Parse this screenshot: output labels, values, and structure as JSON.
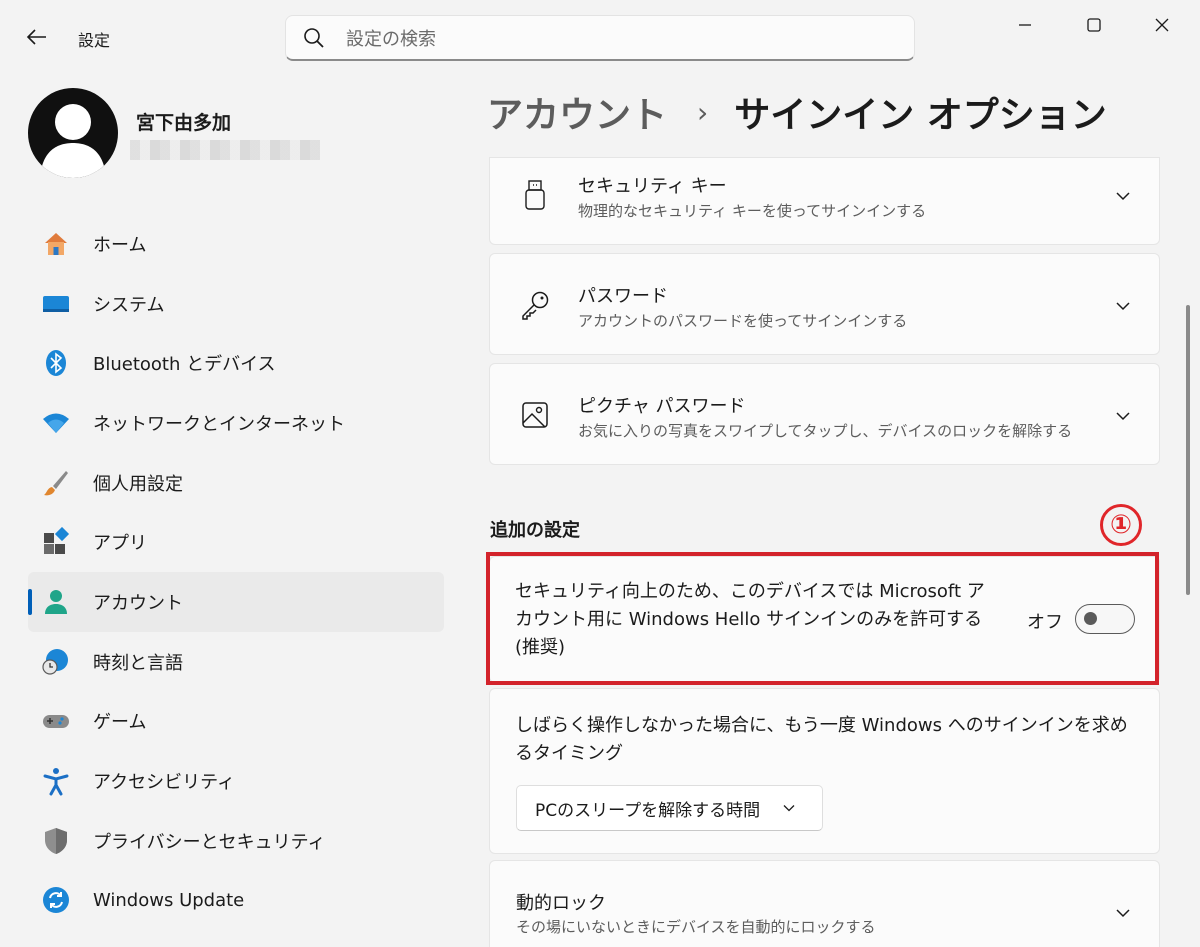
{
  "window": {
    "app_title": "設定"
  },
  "search": {
    "placeholder": "設定の検索"
  },
  "user": {
    "name": "宮下由多加"
  },
  "nav": {
    "items": [
      {
        "label": "ホーム",
        "icon": "home-icon"
      },
      {
        "label": "システム",
        "icon": "system-icon"
      },
      {
        "label": "Bluetooth とデバイス",
        "icon": "bluetooth-icon"
      },
      {
        "label": "ネットワークとインターネット",
        "icon": "wifi-icon"
      },
      {
        "label": "個人用設定",
        "icon": "brush-icon"
      },
      {
        "label": "アプリ",
        "icon": "apps-icon"
      },
      {
        "label": "アカウント",
        "icon": "account-icon",
        "selected": true
      },
      {
        "label": "時刻と言語",
        "icon": "time-language-icon"
      },
      {
        "label": "ゲーム",
        "icon": "gamepad-icon"
      },
      {
        "label": "アクセシビリティ",
        "icon": "accessibility-icon"
      },
      {
        "label": "プライバシーとセキュリティ",
        "icon": "shield-icon"
      },
      {
        "label": "Windows Update",
        "icon": "update-icon"
      }
    ]
  },
  "breadcrumb": {
    "parent": "アカウント",
    "separator": "›",
    "current": "サインイン オプション"
  },
  "options": [
    {
      "title": "セキュリティ キー",
      "desc": "物理的なセキュリティ キーを使ってサインインする",
      "icon": "usb-key-icon"
    },
    {
      "title": "パスワード",
      "desc": "アカウントのパスワードを使ってサインインする",
      "icon": "key-icon"
    },
    {
      "title": "ピクチャ パスワード",
      "desc": "お気に入りの写真をスワイプしてタップし、デバイスのロックを解除する",
      "icon": "picture-icon"
    }
  ],
  "additional": {
    "title": "追加の設定",
    "annotation": "①",
    "hello_only": {
      "text": "セキュリティ向上のため、このデバイスでは Microsoft アカウント用に Windows Hello サインインのみを許可する (推奨)",
      "toggle_label": "オフ",
      "toggle_on": false
    },
    "signin_timeout": {
      "text": "しばらく操作しなかった場合に、もう一度 Windows へのサインインを求めるタイミング",
      "selected": "PCのスリープを解除する時間"
    },
    "dynamic_lock": {
      "title": "動的ロック",
      "desc": "その場にいないときにデバイスを自動的にロックする"
    }
  },
  "colors": {
    "accent": "#005fb8",
    "highlight": "#d3232b",
    "background": "#f3f3f3"
  }
}
